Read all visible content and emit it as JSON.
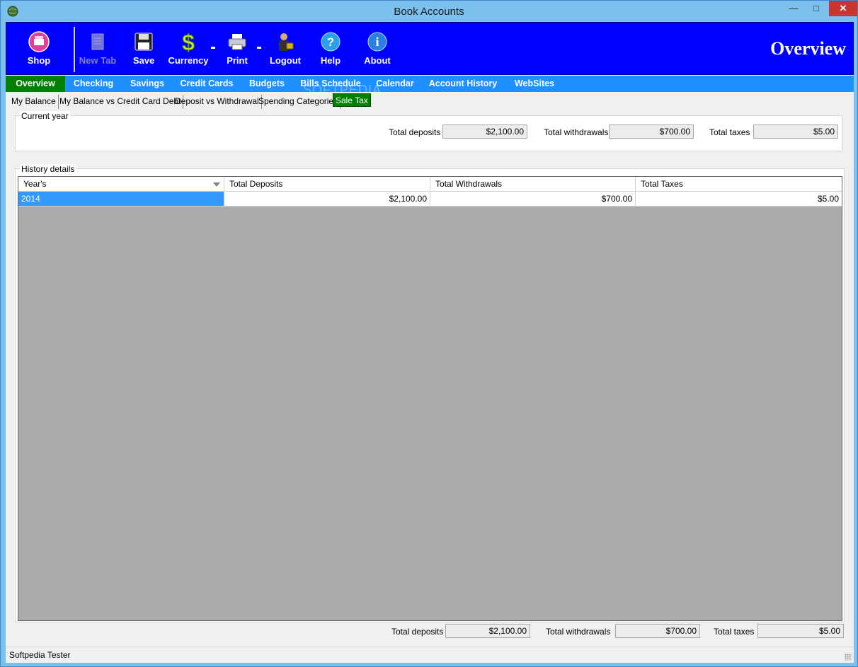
{
  "window": {
    "title": "Book Accounts"
  },
  "toolbar": {
    "buttons": [
      {
        "label": "Shop",
        "icon": "shop-icon"
      },
      {
        "label": "New Tab",
        "icon": "new-tab-icon",
        "disabled": true
      },
      {
        "label": "Save",
        "icon": "floppy-disk-icon"
      },
      {
        "label": "Currency",
        "icon": "dollar-icon"
      },
      {
        "label": "Print",
        "icon": "printer-icon"
      },
      {
        "label": "Logout",
        "icon": "user-lock-icon"
      },
      {
        "label": "Help",
        "icon": "help-icon"
      },
      {
        "label": "About",
        "icon": "info-icon"
      }
    ],
    "page_title": "Overview"
  },
  "main_tabs": [
    "Overview",
    "Checking",
    "Savings",
    "Credit Cards",
    "Budgets",
    "Bills Schedule",
    "Calendar",
    "Account History",
    "WebSites"
  ],
  "active_main_tab": "Overview",
  "watermark": "SOFTPEDIA",
  "sub_tabs": [
    "My Balance",
    "My Balance vs Credit Card Debt",
    "Deposit vs Withdrawal",
    "Spending Categories",
    "Sale Tax"
  ],
  "active_sub_tab": "Sale Tax",
  "current_year": {
    "legend": "Current year",
    "deposits_label": "Total deposits",
    "deposits_value": "$2,100.00",
    "withdrawals_label": "Total withdrawals",
    "withdrawals_value": "$700.00",
    "taxes_label": "Total taxes",
    "taxes_value": "$5.00"
  },
  "history": {
    "legend": "History details",
    "columns": [
      "Year's",
      "Total Deposits",
      "Total Withdrawals",
      "Total Taxes"
    ],
    "rows": [
      [
        "2014",
        "$2,100.00",
        "$700.00",
        "$5.00"
      ]
    ]
  },
  "totals": {
    "deposits_label": "Total deposits",
    "deposits_value": "$2,100.00",
    "withdrawals_label": "Total withdrawals",
    "withdrawals_value": "$700.00",
    "taxes_label": "Total taxes",
    "taxes_value": "$5.00"
  },
  "status": {
    "text": "Softpedia Tester"
  },
  "colors": {
    "toolbar_bg": "#0000ff",
    "tabbar_bg": "#1e90ff",
    "active_tab": "#008000",
    "selection": "#3399ff"
  }
}
